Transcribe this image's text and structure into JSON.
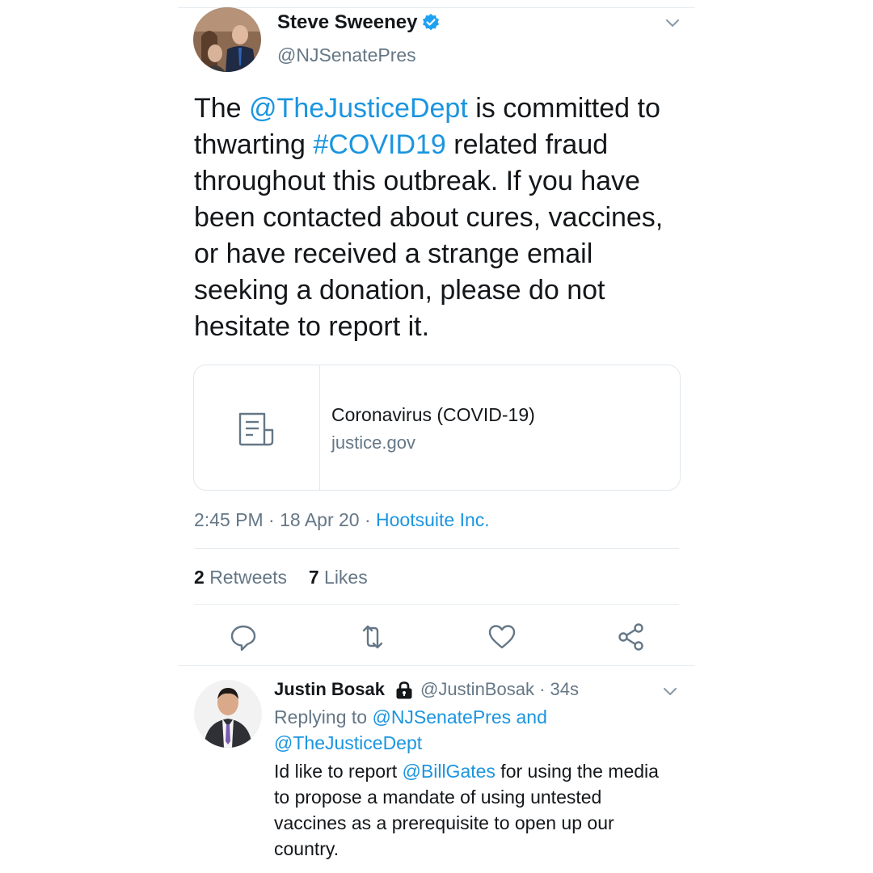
{
  "tweet": {
    "author": {
      "name": "Steve Sweeney",
      "handle": "@NJSenatePres",
      "verified": true
    },
    "text": [
      {
        "t": "The "
      },
      {
        "t": "@TheJusticeDept",
        "link": true
      },
      {
        "t": " is committed to thwarting "
      },
      {
        "t": "#COVID19",
        "link": true
      },
      {
        "t": " related fraud throughout this outbreak. If you have been contacted about cures, vaccines, or have received a strange email seeking a donation, please do not hesitate to report it."
      }
    ],
    "card": {
      "title": "Coronavirus (COVID-19)",
      "domain": "justice.gov",
      "icon": "document-icon"
    },
    "time": "2:45 PM",
    "date": "18 Apr 20",
    "source": "Hootsuite Inc.",
    "retweets_count": "2",
    "retweets_label": "Retweets",
    "likes_count": "7",
    "likes_label": "Likes",
    "actions": [
      "reply-icon",
      "retweet-icon",
      "like-icon",
      "share-icon"
    ]
  },
  "reply": {
    "author": {
      "name": "Justin Bosak",
      "handle": "@JustinBosak",
      "time": "34s",
      "protected": true
    },
    "replying_to": [
      {
        "t": "Replying to "
      },
      {
        "t": "@NJSenatePres",
        "link": true
      },
      {
        "t": " "
      },
      {
        "t": "and",
        "link": true
      },
      {
        "t": " "
      },
      {
        "t": "@TheJusticeDept",
        "link": true
      }
    ],
    "text": [
      {
        "t": "Id like to report "
      },
      {
        "t": "@BillGates",
        "link": true
      },
      {
        "t": " for using the media to propose a mandate of using untested vaccines as a prerequisite to open up our country."
      }
    ]
  },
  "colors": {
    "link": "#1b95e0",
    "verified": "#1da1f2",
    "muted": "#657786",
    "icon": "#657786"
  }
}
